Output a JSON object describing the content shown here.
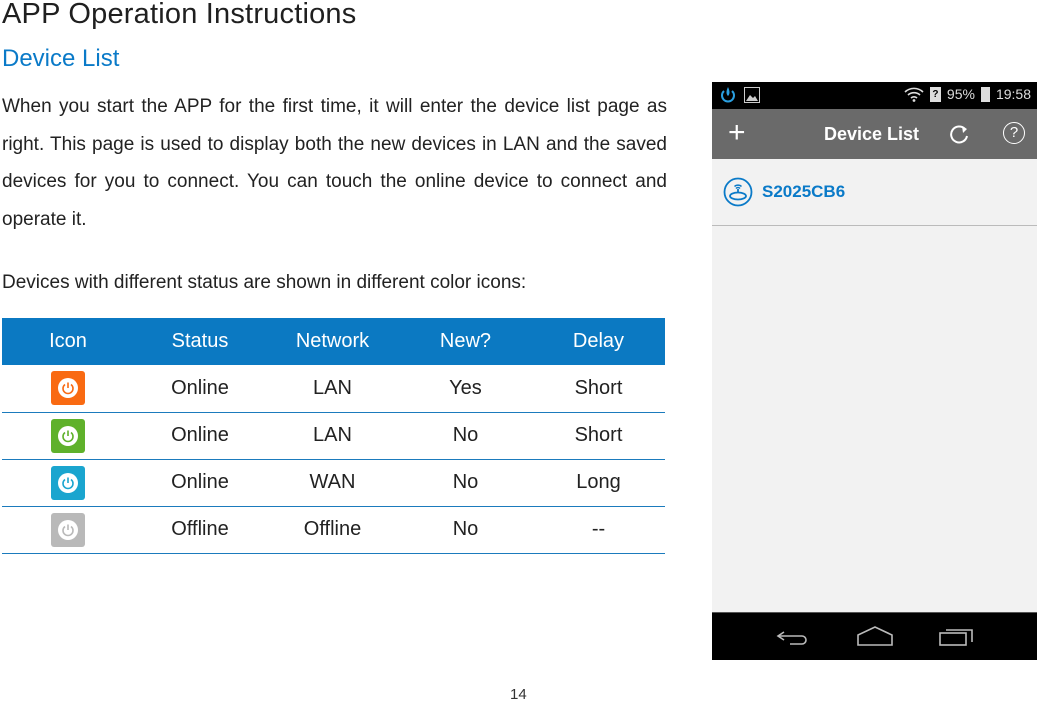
{
  "document": {
    "title": "APP Operation Instructions",
    "subtitle": "Device List",
    "paragraph1": "When you start the APP for the first time, it will enter the device list page as right. This page is used to display both the new devices in LAN and the saved devices for you to connect. You can touch the online device to connect and operate it.",
    "paragraph2": "Devices with different status are shown in different color icons:",
    "page_number": "14"
  },
  "status_table": {
    "headers": [
      "Icon",
      "Status",
      "Network",
      "New?",
      "Delay"
    ],
    "header_color": "#0b79c2",
    "rows": [
      {
        "icon": "power-icon",
        "icon_color": "#f96a12",
        "status": "Online",
        "network": "LAN",
        "new": "Yes",
        "delay": "Short"
      },
      {
        "icon": "power-icon",
        "icon_color": "#5fb12b",
        "status": "Online",
        "network": "LAN",
        "new": "No",
        "delay": "Short"
      },
      {
        "icon": "power-icon",
        "icon_color": "#1aa5cf",
        "status": "Online",
        "network": "WAN",
        "new": "No",
        "delay": "Long"
      },
      {
        "icon": "power-icon",
        "icon_color": "#b9b9b9",
        "status": "Offline",
        "network": "Offline",
        "new": "No",
        "delay": "--"
      }
    ]
  },
  "phone": {
    "status_bar": {
      "battery": "95%",
      "time": "19:58",
      "icons": [
        "app-power-icon",
        "image-icon",
        "wifi-icon",
        "sim-unknown-icon",
        "battery-icon"
      ]
    },
    "app_bar": {
      "title": "Device List",
      "add_icon": "plus-icon",
      "refresh_icon": "refresh-icon",
      "help_label": "?"
    },
    "devices": [
      {
        "name": "S2025CB6",
        "icon": "router-icon"
      }
    ],
    "nav_bar": [
      "back-icon",
      "home-icon",
      "recent-apps-icon"
    ],
    "accent_color": "#0a7ac8"
  }
}
